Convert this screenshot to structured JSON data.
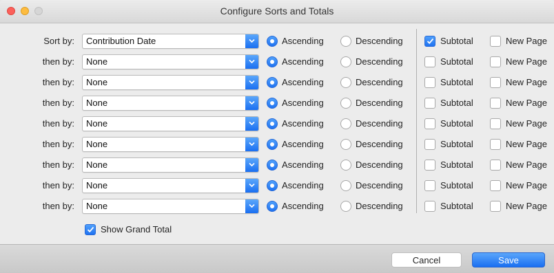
{
  "window": {
    "title": "Configure Sorts and Totals"
  },
  "colors": {
    "accent": "#1f72f1",
    "close": "#fc605b",
    "minimize": "#fdbc40"
  },
  "rows": [
    {
      "label": "Sort by:",
      "field": "Contribution Date",
      "ascending": "Ascending",
      "descending": "Descending",
      "subtotal": "Subtotal",
      "new_page": "New Page",
      "subtotal_checked": true
    },
    {
      "label": "then by:",
      "field": "None",
      "ascending": "Ascending",
      "descending": "Descending",
      "subtotal": "Subtotal",
      "new_page": "New Page",
      "subtotal_checked": false
    },
    {
      "label": "then by:",
      "field": "None",
      "ascending": "Ascending",
      "descending": "Descending",
      "subtotal": "Subtotal",
      "new_page": "New Page",
      "subtotal_checked": false
    },
    {
      "label": "then by:",
      "field": "None",
      "ascending": "Ascending",
      "descending": "Descending",
      "subtotal": "Subtotal",
      "new_page": "New Page",
      "subtotal_checked": false
    },
    {
      "label": "then by:",
      "field": "None",
      "ascending": "Ascending",
      "descending": "Descending",
      "subtotal": "Subtotal",
      "new_page": "New Page",
      "subtotal_checked": false
    },
    {
      "label": "then by:",
      "field": "None",
      "ascending": "Ascending",
      "descending": "Descending",
      "subtotal": "Subtotal",
      "new_page": "New Page",
      "subtotal_checked": false
    },
    {
      "label": "then by:",
      "field": "None",
      "ascending": "Ascending",
      "descending": "Descending",
      "subtotal": "Subtotal",
      "new_page": "New Page",
      "subtotal_checked": false
    },
    {
      "label": "then by:",
      "field": "None",
      "ascending": "Ascending",
      "descending": "Descending",
      "subtotal": "Subtotal",
      "new_page": "New Page",
      "subtotal_checked": false
    },
    {
      "label": "then by:",
      "field": "None",
      "ascending": "Ascending",
      "descending": "Descending",
      "subtotal": "Subtotal",
      "new_page": "New Page",
      "subtotal_checked": false
    }
  ],
  "grand_total": {
    "label": "Show Grand Total",
    "checked": true
  },
  "footer": {
    "cancel_label": "Cancel",
    "save_label": "Save"
  }
}
